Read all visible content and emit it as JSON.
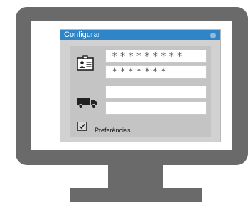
{
  "window": {
    "title": "Configurar"
  },
  "credentials": {
    "username_value": "*********",
    "password_value": "*******"
  },
  "delivery": {
    "field1_value": "",
    "field2_value": ""
  },
  "preferences": {
    "label": "Preferências",
    "checked": true
  },
  "colors": {
    "monitor": "#6a6a6a",
    "titlebar": "#2e86c9",
    "panel": "#c4c4c4"
  },
  "icons": [
    "id-card-icon",
    "truck-icon",
    "checkmark-icon",
    "window-dot-icon"
  ]
}
